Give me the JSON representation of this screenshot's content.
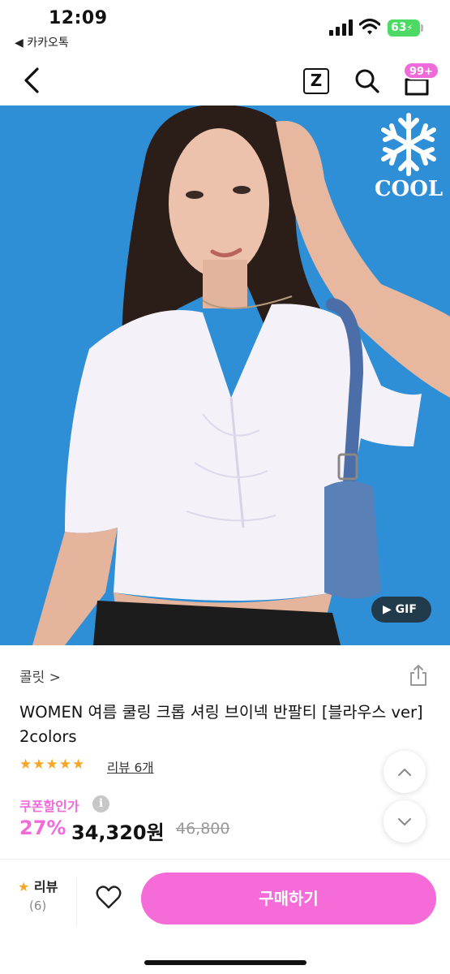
{
  "status_bar": {
    "time": "12:09",
    "back_app": "◀ 카카오톡",
    "battery": "63"
  },
  "nav": {
    "z_label": "Z",
    "cart_badge": "99+"
  },
  "hero": {
    "cool_label": "COOL",
    "gif_label": "▶ GIF"
  },
  "product": {
    "brand": "콜릿 >",
    "title": "WOMEN 여름 쿨링 크롭 셔링 브이넥 반팔티 [블라우스 ver] 2colors",
    "stars": "★★★★★",
    "review_link": "리뷰 6개",
    "coupon_label": "쿠폰할인가",
    "discount": "27%",
    "price": "34,320원",
    "original_price": "46,800"
  },
  "bottom_bar": {
    "review_title": "리뷰",
    "review_count": "(6)",
    "buy_label": "구매하기"
  },
  "colors": {
    "accent": "#f06ad9",
    "hero_bg": "#2e8fd6",
    "star": "#f5a623"
  }
}
